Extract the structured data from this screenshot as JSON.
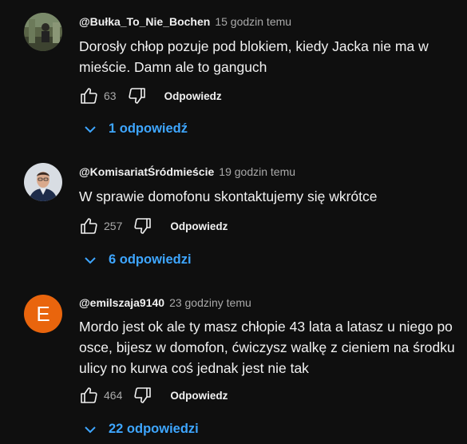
{
  "comments": [
    {
      "author": "@Bułka_To_Nie_Bochen",
      "time": "15 godzin temu",
      "text": "Dorosły chłop pozuje pod blokiem, kiedy Jacka nie ma w mieście. Damn ale to ganguch",
      "likes": "63",
      "reply_label": "Odpowiedz",
      "replies_label": "1 odpowiedź",
      "avatar": "photo-person-outdoor"
    },
    {
      "author": "@KomisariatŚródmieście",
      "time": "19 godzin temu",
      "text": "W sprawie domofonu skontaktujemy się wkrótce",
      "likes": "257",
      "reply_label": "Odpowiedz",
      "replies_label": "6 odpowiedzi",
      "avatar": "photo-police-officer"
    },
    {
      "author": "@emilszaja9140",
      "time": "23 godziny temu",
      "text": "Mordo jest ok ale ty masz chłopie 43 lata a latasz u niego po osce, bijesz w domofon, ćwiczysz walkę z cieniem na środku ulicy no kurwa coś jednak jest nie tak",
      "likes": "464",
      "reply_label": "Odpowiedz",
      "replies_label": "22 odpowiedzi",
      "avatar_letter": "E",
      "avatar_color": "#e9650d"
    }
  ],
  "colors": {
    "background": "#0f0f0f",
    "link": "#3ea6ff",
    "secondary_text": "#aaaaaa"
  }
}
